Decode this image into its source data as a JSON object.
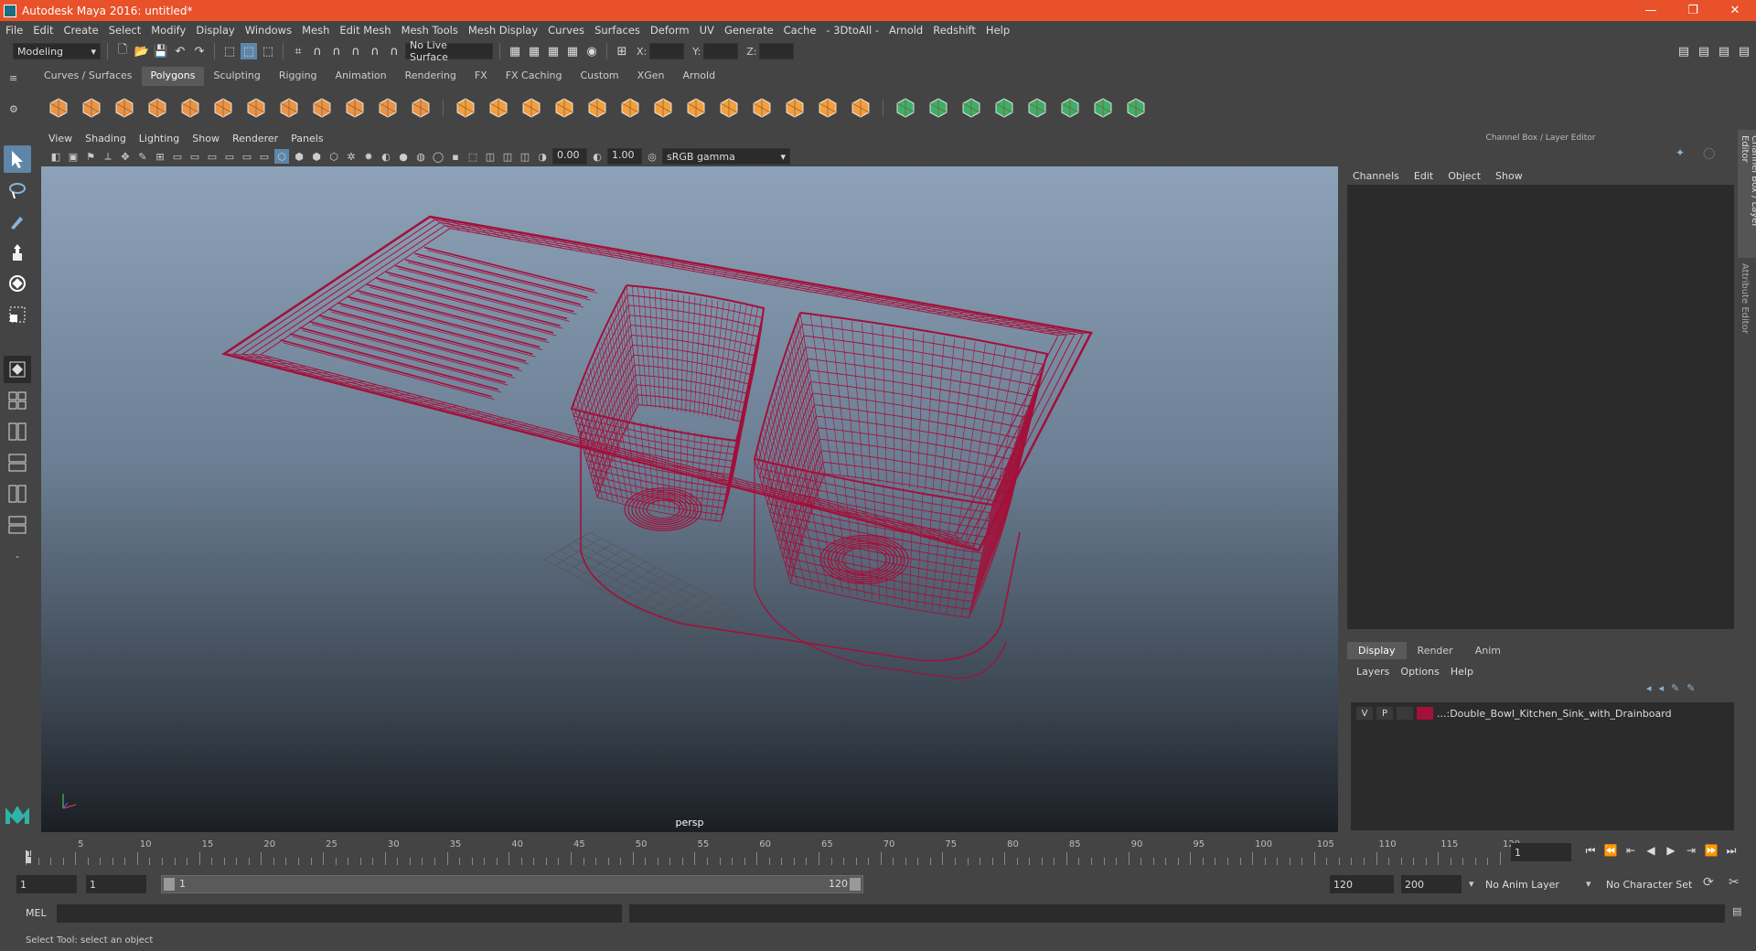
{
  "window": {
    "title": "Autodesk Maya 2016: untitled*",
    "controls": [
      "—",
      "❐",
      "✕"
    ]
  },
  "menubar": [
    "File",
    "Edit",
    "Create",
    "Select",
    "Modify",
    "Display",
    "Windows",
    "Mesh",
    "Edit Mesh",
    "Mesh Tools",
    "Mesh Display",
    "Curves",
    "Surfaces",
    "Deform",
    "UV",
    "Generate",
    "Cache",
    "- 3DtoAll -",
    "Arnold",
    "Redshift",
    "Help"
  ],
  "statusline": {
    "mode": "Modeling",
    "live_surface": "No Live Surface",
    "x_label": "X:",
    "y_label": "Y:",
    "z_label": "Z:"
  },
  "shelf_tabs": [
    "Curves / Surfaces",
    "Polygons",
    "Sculpting",
    "Rigging",
    "Animation",
    "Rendering",
    "FX",
    "FX Caching",
    "Custom",
    "XGen",
    "Arnold"
  ],
  "shelf_active": "Polygons",
  "viewport": {
    "menu": [
      "View",
      "Shading",
      "Lighting",
      "Show",
      "Renderer",
      "Panels"
    ],
    "exposure": "0.00",
    "gamma": "1.00",
    "color_space": "sRGB gamma",
    "camera": "persp",
    "wire_color": "#a3103a"
  },
  "channel_box": {
    "header": "Channel Box / Layer Editor",
    "menu": [
      "Channels",
      "Edit",
      "Object",
      "Show"
    ]
  },
  "layer_editor": {
    "tabs": [
      "Display",
      "Render",
      "Anim"
    ],
    "active_tab": "Display",
    "menu": [
      "Layers",
      "Options",
      "Help"
    ],
    "layer": {
      "v": "V",
      "p": "P",
      "color": "#a3103a",
      "name": "...:Double_Bowl_Kitchen_Sink_with_Drainboard"
    }
  },
  "side_tabs": [
    "Channel Box / Layer Editor",
    "Attribute Editor"
  ],
  "timeline": {
    "labels": [
      "5",
      "10",
      "15",
      "20",
      "25",
      "30",
      "35",
      "40",
      "45",
      "50",
      "55",
      "60",
      "65",
      "70",
      "75",
      "80",
      "85",
      "90",
      "95",
      "100",
      "105",
      "110",
      "115",
      "120"
    ],
    "start_marker": "1",
    "current_frame": "1"
  },
  "range": {
    "start": "1",
    "playback_start": "1",
    "slider_start": "1",
    "slider_end": "120",
    "playback_end": "120",
    "end": "200",
    "anim_layer": "No Anim Layer",
    "char_set": "No Character Set"
  },
  "cmdline": {
    "label": "MEL"
  },
  "helpline": "Select Tool: select an object"
}
